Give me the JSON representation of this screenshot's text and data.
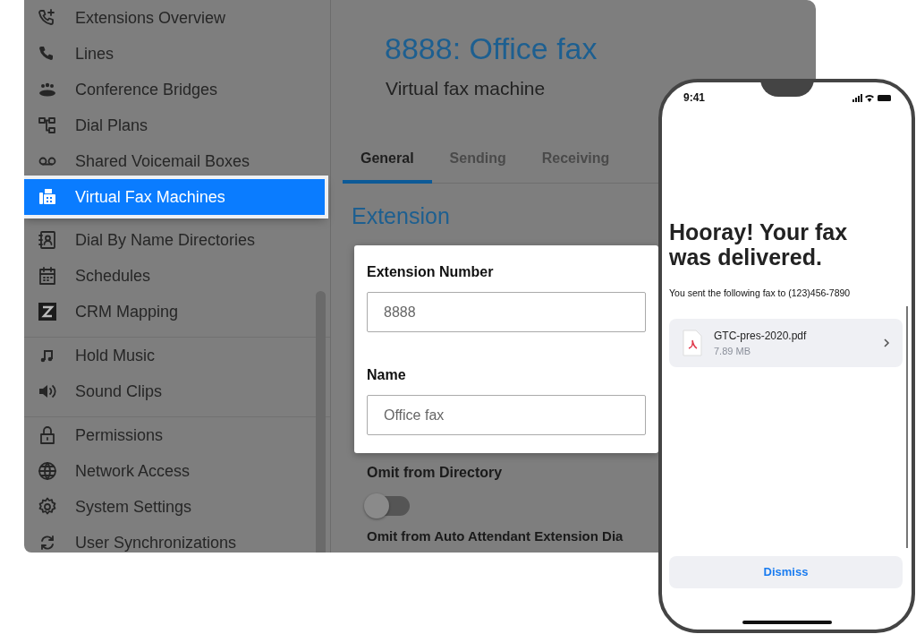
{
  "sidebar": {
    "groups": [
      {
        "items": [
          {
            "label": "Extensions Overview",
            "selected": false
          },
          {
            "label": "Lines",
            "selected": false
          },
          {
            "label": "Conference Bridges",
            "selected": false
          },
          {
            "label": "Dial Plans",
            "selected": false
          },
          {
            "label": "Shared Voicemail Boxes",
            "selected": false
          },
          {
            "label": "Virtual Fax Machines",
            "selected": true
          },
          {
            "label": "Dial By Name Directories",
            "selected": false
          },
          {
            "label": "Schedules",
            "selected": false
          },
          {
            "label": "CRM Mapping",
            "selected": false
          }
        ]
      },
      {
        "items": [
          {
            "label": "Hold Music",
            "selected": false
          },
          {
            "label": "Sound Clips",
            "selected": false
          }
        ]
      },
      {
        "items": [
          {
            "label": "Permissions",
            "selected": false
          },
          {
            "label": "Network Access",
            "selected": false
          },
          {
            "label": "System Settings",
            "selected": false
          },
          {
            "label": "User Synchronizations",
            "selected": false
          }
        ]
      }
    ]
  },
  "main": {
    "title": "8888: Office fax",
    "subtitle": "Virtual fax machine",
    "tabs": [
      {
        "label": "General",
        "selected": true
      },
      {
        "label": "Sending",
        "selected": false
      },
      {
        "label": "Receiving",
        "selected": false
      }
    ],
    "section_title": "Extension",
    "fields": [
      {
        "label": "Extension Number",
        "value": "8888"
      },
      {
        "label": "Name",
        "value": "Office fax"
      }
    ],
    "settings": [
      {
        "kind": "toggle",
        "label": "Omit from Directory",
        "on": false
      },
      {
        "kind": "label",
        "label": "Omit from Auto Attendant Extension Dia"
      }
    ]
  },
  "phone": {
    "time": "9:41",
    "heading": "Hooray! Your fax was delivered.",
    "message": "You sent the following fax to (123)456-7890",
    "attachment": {
      "name": "GTC-pres-2020.pdf",
      "size": "7.89 MB"
    },
    "button": "Dismiss"
  }
}
